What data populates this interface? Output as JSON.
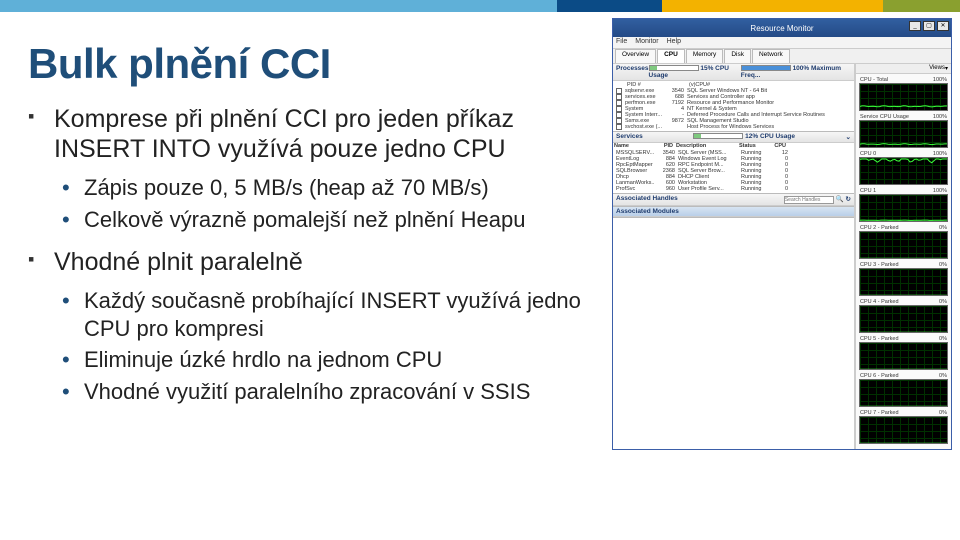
{
  "topbar_colors": [
    "#5fb0d8",
    "#0b4b86",
    "#f3b200",
    "#8aa02f"
  ],
  "title": "Bulk plnění CCI",
  "bullets": [
    {
      "level": 1,
      "text": "Komprese při plnění CCI pro jeden příkaz INSERT INTO využívá pouze jedno CPU"
    },
    {
      "level": 2,
      "text": "Zápis pouze 0, 5 MB/s (heap až 70 MB/s)"
    },
    {
      "level": 2,
      "text": "Celkově výrazně pomalejší než plnění Heapu"
    },
    {
      "level": 1,
      "text": "Vhodné plnit paralelně"
    },
    {
      "level": 2,
      "text": "Každý současně probíhající INSERT využívá jedno CPU pro kompresi"
    },
    {
      "level": 2,
      "text": "Eliminuje úzké hrdlo na jednom CPU"
    },
    {
      "level": 2,
      "text": "Vhodné využití paralelního zpracování v SSIS"
    }
  ],
  "rm": {
    "window_title": "Resource Monitor",
    "win_btns": {
      "min": "_",
      "max": "▢",
      "close": "✕"
    },
    "menu": [
      "File",
      "Monitor",
      "Help"
    ],
    "tabs": [
      "Overview",
      "CPU",
      "Memory",
      "Disk",
      "Network"
    ],
    "active_tab": 1,
    "proc_header": {
      "label": "Processes",
      "cpu_usage": "15% CPU Usage",
      "max_freq": "100% Maximum Freq..."
    },
    "processes": [
      {
        "name": "PID #",
        "pid": "",
        "desc": "(v)CPU#"
      },
      {
        "name": "sqlservr.exe",
        "pid": "3540",
        "desc": "SQL Server Windows NT - 64 Bit"
      },
      {
        "name": "services.exe",
        "pid": "688",
        "desc": "Services and Controller app"
      },
      {
        "name": "perfmon.exe",
        "pid": "7192",
        "desc": "Resource and Performance Monitor"
      },
      {
        "name": "System",
        "pid": "4",
        "desc": "NT Kernel & System"
      },
      {
        "name": "System Interr...",
        "pid": "-",
        "desc": "Deferred Procedure Calls and Interrupt Service Routines"
      },
      {
        "name": "Ssms.exe",
        "pid": "9872",
        "desc": "SQL Management Studio"
      },
      {
        "name": "svchost.exe (...",
        "pid": "",
        "desc": "Host Process for Windows Services"
      }
    ],
    "svc_header": {
      "label": "Services",
      "cpu": "12% CPU Usage",
      "arrow": "⌄"
    },
    "svc_cols": [
      "Name",
      "PID",
      "Description",
      "Status",
      "CPU"
    ],
    "services": [
      {
        "name": "MSSQLSERV...",
        "pid": "3540",
        "desc": "SQL Server (MSS...",
        "status": "Running",
        "cpu": "12"
      },
      {
        "name": "EventLog",
        "pid": "884",
        "desc": "Windows Event Log",
        "status": "Running",
        "cpu": "0"
      },
      {
        "name": "RpcEptMapper",
        "pid": "620",
        "desc": "RPC Endpoint M...",
        "status": "Running",
        "cpu": "0"
      },
      {
        "name": "SQLBrowser",
        "pid": "2368",
        "desc": "SQL Server Brow...",
        "status": "Running",
        "cpu": "0"
      },
      {
        "name": "Dhcp",
        "pid": "884",
        "desc": "DHCP Client",
        "status": "Running",
        "cpu": "0"
      },
      {
        "name": "LanmanWorks...",
        "pid": "600",
        "desc": "Workstation",
        "status": "Running",
        "cpu": "0"
      },
      {
        "name": "ProfSvc",
        "pid": "960",
        "desc": "User Profile Serv...",
        "status": "Running",
        "cpu": "0"
      }
    ],
    "assoc_handles": "Associated Handles",
    "assoc_modules": "Associated Modules",
    "search_placeholder": "Search Handles",
    "views_btn": "Views",
    "charts": [
      {
        "title": "CPU - Total",
        "pct": "100%",
        "load": 0.15
      },
      {
        "title": "Service CPU Usage",
        "pct": "100%",
        "load": 0.12
      },
      {
        "title": "CPU 0",
        "pct": "100%",
        "load": 0.95
      },
      {
        "title": "CPU 1",
        "pct": "100%",
        "load": 0.04
      },
      {
        "title": "CPU 2 - Parked",
        "pct": "0%",
        "load": 0.0
      },
      {
        "title": "CPU 3 - Parked",
        "pct": "0%",
        "load": 0.0
      },
      {
        "title": "CPU 4 - Parked",
        "pct": "0%",
        "load": 0.0
      },
      {
        "title": "CPU 5 - Parked",
        "pct": "0%",
        "load": 0.0
      },
      {
        "title": "CPU 6 - Parked",
        "pct": "0%",
        "load": 0.0
      },
      {
        "title": "CPU 7 - Parked",
        "pct": "0%",
        "load": 0.0
      }
    ]
  }
}
